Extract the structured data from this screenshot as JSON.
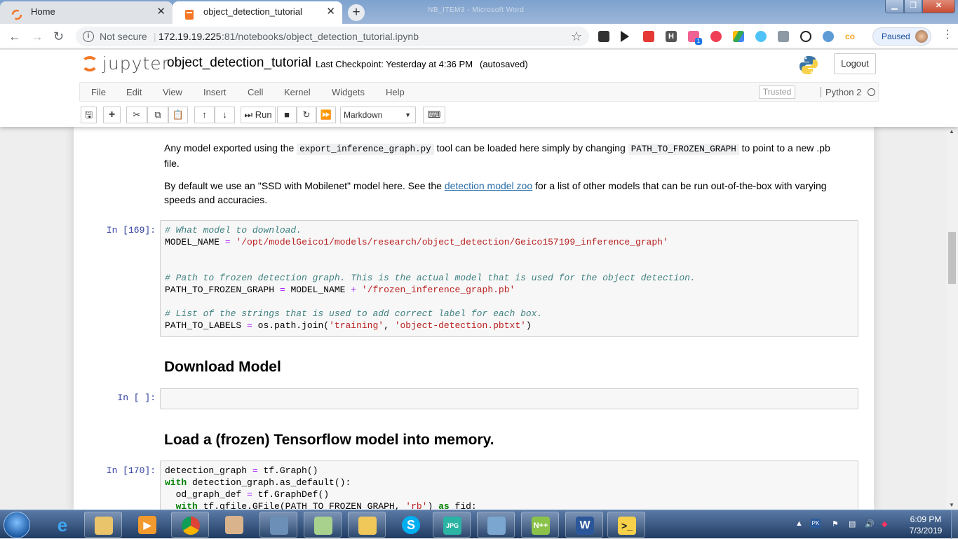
{
  "browser": {
    "tabs": [
      {
        "title": "Home",
        "active": false
      },
      {
        "title": "object_detection_tutorial",
        "active": true
      }
    ],
    "window_title": "NB_ITEM3 - Microsoft Word",
    "address": {
      "security_label": "Not secure",
      "host": "172.19.19.225",
      "path": ":81/notebooks/object_detection_tutorial.ipynb"
    },
    "profile_label": "Paused",
    "extensions": [
      "camera-icon",
      "play-icon",
      "youtube-icon",
      "h-icon",
      "puzzle-icon",
      "pocket-icon",
      "drive-icon",
      "cloud-icon",
      "image-icon",
      "clock-icon",
      "weather-icon",
      "co-icon"
    ],
    "extension_badge": "1"
  },
  "jupyter": {
    "logo_text": "jupyter",
    "notebook_name": "object_detection_tutorial",
    "checkpoint": "Last Checkpoint: Yesterday at 4:36 PM",
    "autosave": "(autosaved)",
    "logout": "Logout",
    "menu": [
      "File",
      "Edit",
      "View",
      "Insert",
      "Cell",
      "Kernel",
      "Widgets",
      "Help"
    ],
    "trusted": "Trusted",
    "kernel": "Python 2",
    "toolbar": {
      "run_label": "Run",
      "cell_type": "Markdown"
    }
  },
  "cells": {
    "md1_a": "Any model exported using the",
    "md1_code1": "export_inference_graph.py",
    "md1_b": "tool can be loaded here simply by changing",
    "md1_code2": "PATH_TO_FROZEN_GRAPH",
    "md1_c": "to point to a new .pb",
    "md1_d": "file.",
    "md2_a": "By default we use an \"SSD with Mobilenet\" model here. See the",
    "md2_link": "detection model zoo",
    "md2_b": "for a list of other models that can be run out-of-the-box with varying",
    "md2_c": "speeds and accuracies.",
    "prompt1": "In [169]:",
    "code1": [
      "# What model to download.",
      "MODEL_NAME = '/opt/modelGeico1/models/research/object_detection/Geico157199_inference_graph'",
      "# Path to frozen detection graph. This is the actual model that is used for the object detection.",
      "PATH_TO_FROZEN_GRAPH = MODEL_NAME + '/frozen_inference_graph.pb'",
      "# List of the strings that is used to add correct label for each box.",
      "PATH_TO_LABELS = os.path.join('training', 'object-detection.pbtxt')"
    ],
    "heading_download": "Download Model",
    "prompt2": "In [ ]:",
    "heading_load": "Load a (frozen) Tensorflow model into memory.",
    "prompt3": "In [170]:",
    "code3": [
      "detection_graph = tf.Graph()",
      "with detection_graph.as_default():",
      "  od_graph_def = tf.GraphDef()",
      "  with tf.gfile.GFile(PATH_TO_FROZEN_GRAPH, 'rb') as fid:"
    ]
  },
  "taskbar": {
    "apps": [
      "ie-icon",
      "explorer-icon",
      "media-player-icon",
      "chrome-icon",
      "paint-icon",
      "network-icon",
      "folder-icon",
      "outlook-icon",
      "skype-icon",
      "jpg-icon",
      "photo-viewer-icon",
      "notepadpp-icon",
      "word-icon",
      "python-icon"
    ],
    "time": "6:09 PM",
    "date": "7/3/2019"
  },
  "colors": {
    "jupyter_orange": "#f37726",
    "prompt_blue": "#303f9f",
    "link": "#296eaa"
  }
}
